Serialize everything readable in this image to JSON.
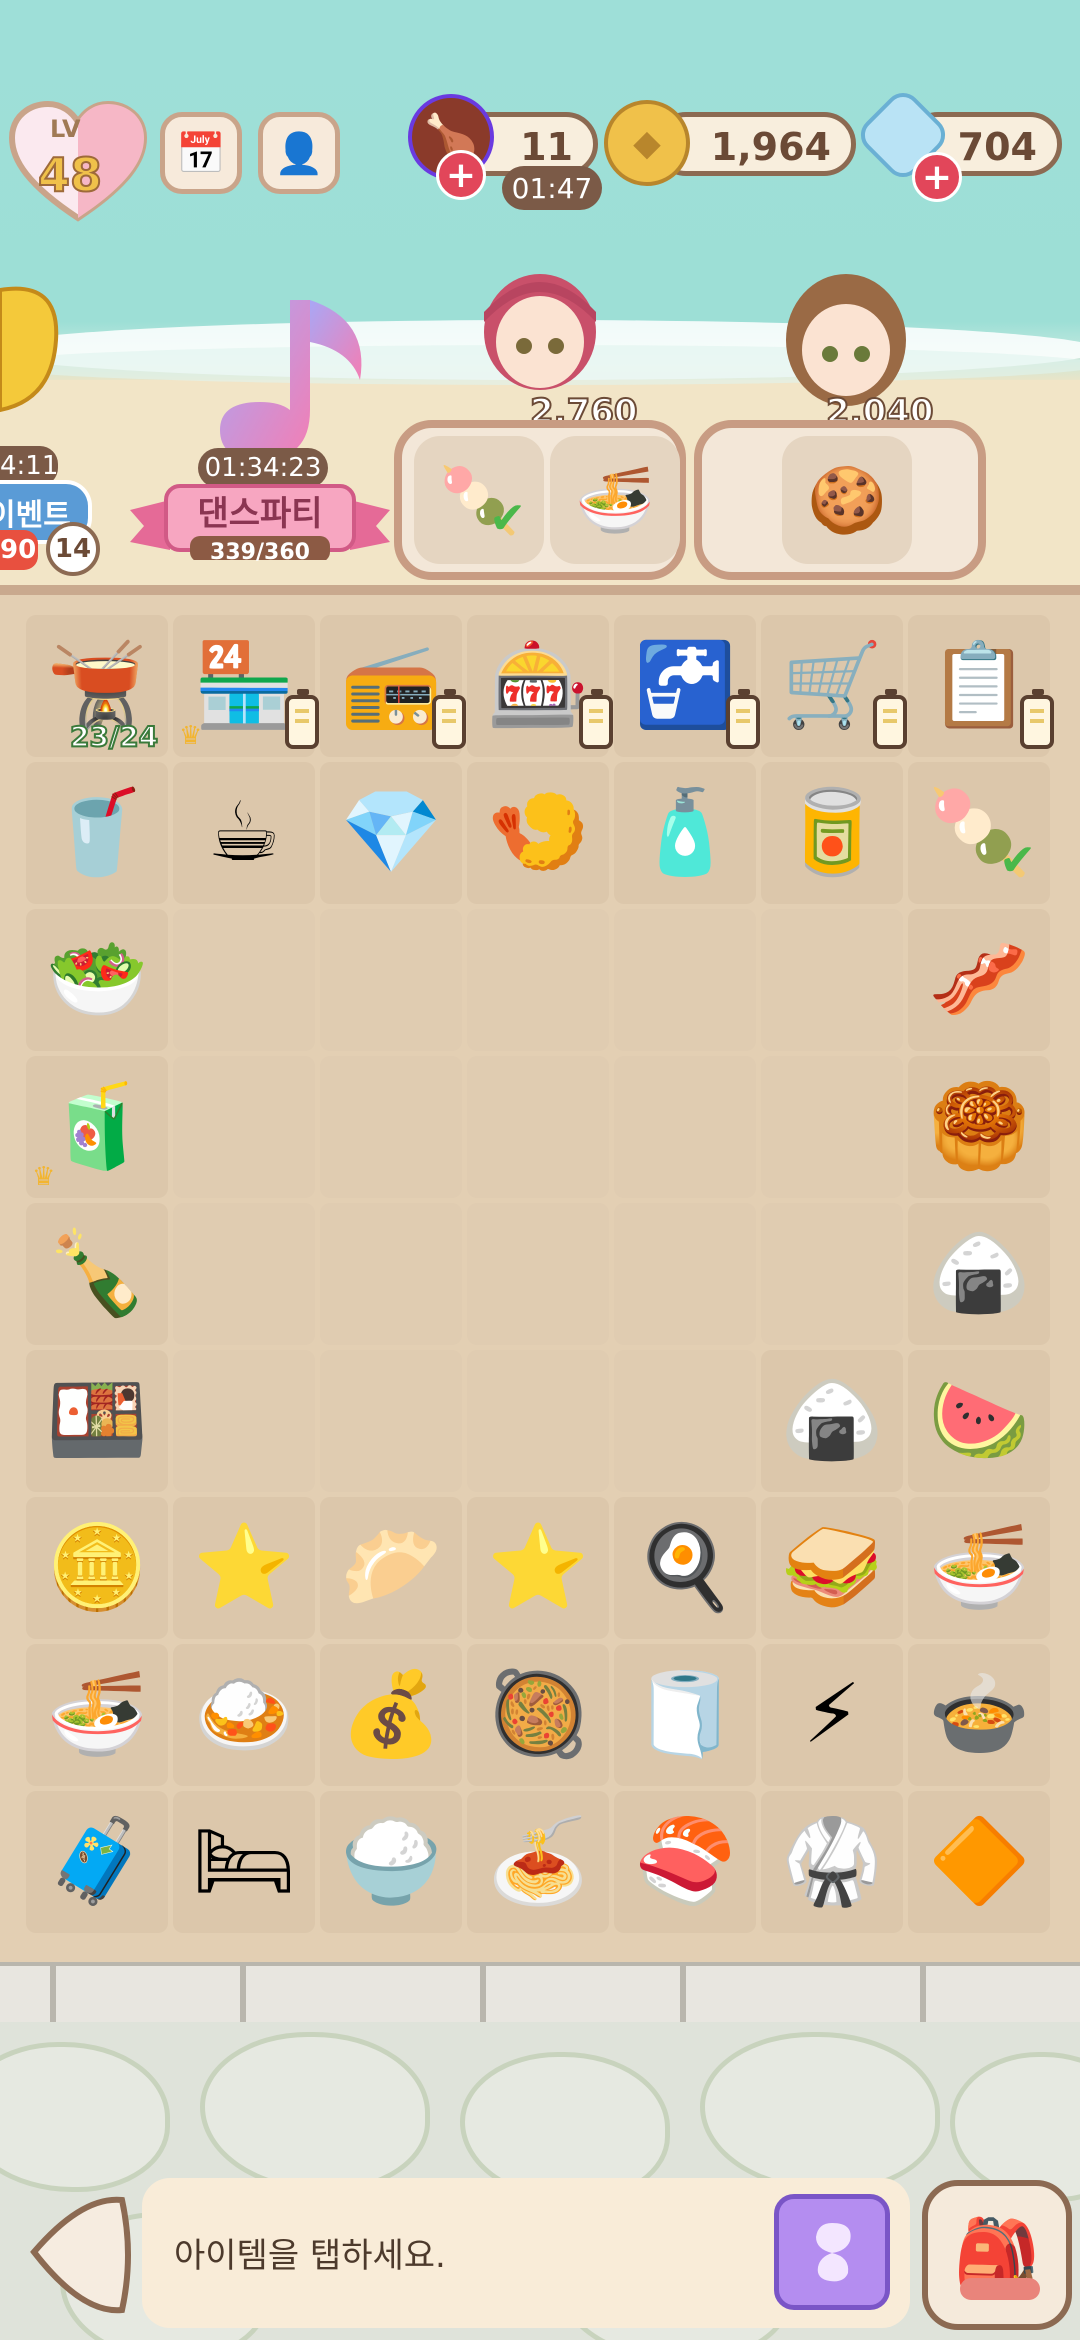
{
  "level": {
    "label": "LV",
    "value": "48"
  },
  "resources": {
    "energy": {
      "value": "11",
      "timer": "01:47",
      "icon": "drumstick-icon"
    },
    "coins": {
      "value": "1,964",
      "icon": "coin-icon"
    },
    "gems": {
      "value": "704",
      "icon": "gem-icon"
    }
  },
  "left_event": {
    "timer": "4:11",
    "name": "이벤트",
    "score": "90",
    "badge": "14"
  },
  "dance_party": {
    "timer": "01:34:23",
    "name": "댄스파티",
    "progress": "339/360"
  },
  "customers": [
    {
      "reward": "2,760",
      "order_items": [
        "green-tea-rice-cake",
        "ramen-set"
      ]
    },
    {
      "reward": "2,040",
      "order_items": [
        "cookie-plate"
      ]
    }
  ],
  "board": {
    "cauldron_count": "23/24",
    "rows": [
      [
        "cauldron",
        "cat-shop",
        "microwave",
        "vending-machine",
        "sink",
        "luggage-cart",
        "menu-clipboard"
      ],
      [
        "frappe",
        "coffee-cup",
        "crystal",
        "fry-basket",
        "lotion",
        "bento-tin",
        "rice-cake-basket"
      ],
      [
        "salad",
        "",
        "",
        "",
        "",
        "",
        "bacon-rolls"
      ],
      [
        "drink-box",
        "",
        "",
        "",
        "",
        "",
        "cake-roll"
      ],
      [
        "soju-plate",
        "",
        "",
        "",
        "",
        "",
        "mochi"
      ],
      [
        "bento-box",
        "",
        "",
        "",
        "",
        "onigiri",
        "watermelon"
      ],
      [
        "coins-small",
        "stars-two",
        "dumplings",
        "star",
        "fried-egg",
        "fruit-sando",
        "cup-ramen"
      ],
      [
        "ramen-bowl",
        "tempura-bowl",
        "coins-big",
        "bibimbap",
        "towel",
        "lightning",
        "big-ramen"
      ],
      [
        "suitcase",
        "blanket",
        "rice-bowl-lid",
        "noodle-bowl",
        "sushi-pack",
        "bathrobe",
        "amber-crystal"
      ]
    ]
  },
  "hint": {
    "text": "아이템을 탭하세요."
  },
  "colors": {
    "sky": "#9edfd8",
    "board": "#dcc7ab",
    "accent": "#8c6a52",
    "hint_button": "#b48df0"
  }
}
